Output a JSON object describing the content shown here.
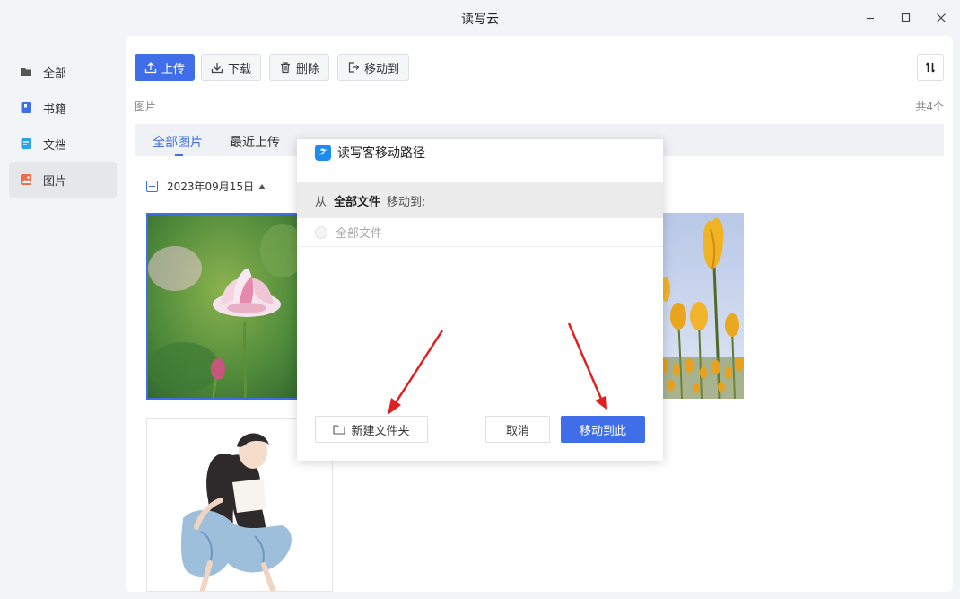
{
  "app": {
    "title": "读写云"
  },
  "window_controls": {
    "minimize": "minimize-icon",
    "maximize": "maximize-icon",
    "close": "close-icon"
  },
  "sidebar": {
    "items": [
      {
        "label": "全部",
        "icon": "folder-icon",
        "color": "#555555"
      },
      {
        "label": "书籍",
        "icon": "book-icon",
        "color": "#3f6ee8"
      },
      {
        "label": "文档",
        "icon": "document-icon",
        "color": "#2ba3e8"
      },
      {
        "label": "图片",
        "icon": "image-icon",
        "color": "#f26b4a",
        "active": true
      }
    ]
  },
  "toolbar": {
    "upload": "上传",
    "download": "下载",
    "delete": "删除",
    "move_to": "移动到"
  },
  "breadcrumb": "图片",
  "total_count": "共4个",
  "tabs": [
    {
      "label": "全部图片",
      "active": true
    },
    {
      "label": "最近上传",
      "active": false
    }
  ],
  "date_group": "2023年09月15日",
  "dialog": {
    "title": "读写客移动路径",
    "path_from": "从",
    "path_source": "全部文件",
    "path_suffix": "移动到:",
    "folder_option": "全部文件",
    "new_folder_button": "新建文件夹",
    "cancel_button": "取消",
    "confirm_button": "移动到此"
  },
  "colors": {
    "accent": "#3f6ee8",
    "annotation_arrow": "#e02020"
  }
}
